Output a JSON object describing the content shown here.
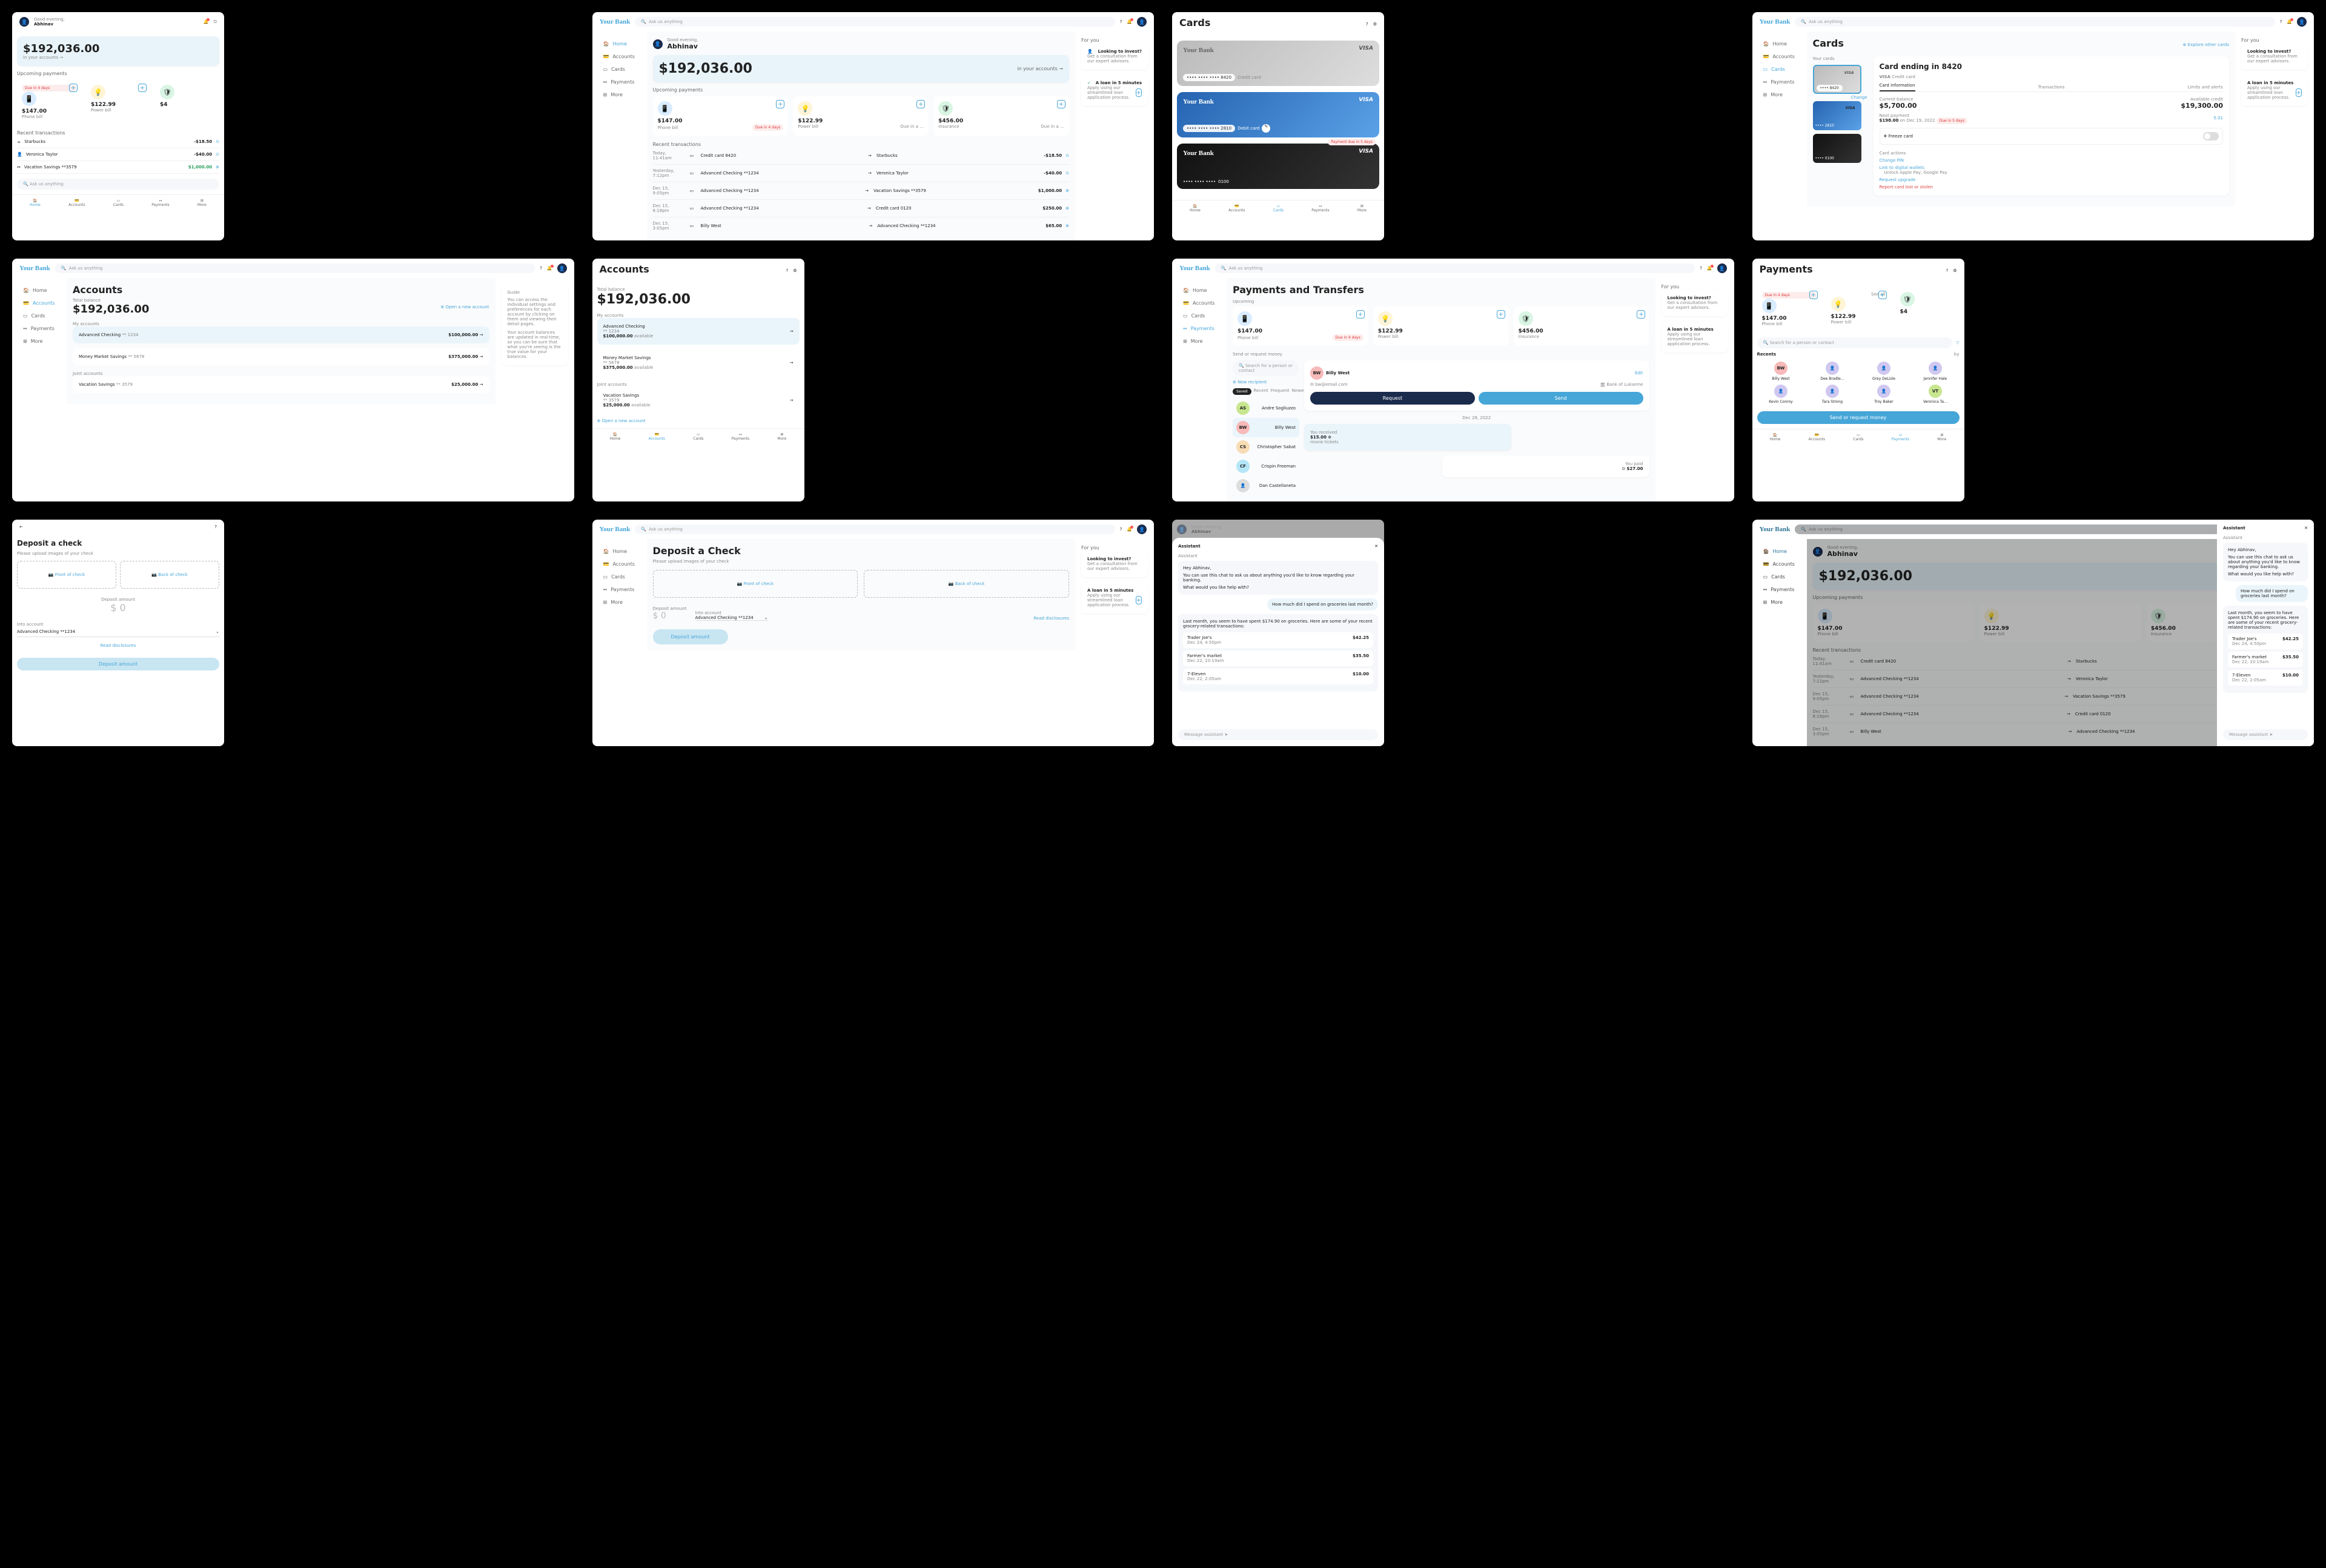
{
  "brand": "Your Bank",
  "search_placeholder": "Ask us anything",
  "greeting": {
    "label": "Good evening,",
    "name": "Abhinav"
  },
  "balance": {
    "amount": "$192,036.00",
    "sub": "in your accounts",
    "arrow": "→"
  },
  "nav": {
    "home": "Home",
    "accounts": "Accounts",
    "cards": "Cards",
    "payments": "Payments",
    "more": "More"
  },
  "upcoming": {
    "title": "Upcoming payments",
    "see_all": "See all",
    "items": [
      {
        "amt": "$147.00",
        "label": "Phone bill",
        "due": "Due in 4 days",
        "urgent": true,
        "icon": "📱"
      },
      {
        "amt": "$122.99",
        "label": "Power bill",
        "due": "Due in a …",
        "icon": "💡"
      },
      {
        "amt": "$456.00",
        "label": "Insurance",
        "due": "Due in a …",
        "icon": "🛡"
      }
    ]
  },
  "recent": {
    "title": "Recent transactions",
    "rows": [
      {
        "time": "Today, 11:41am",
        "acc": "Credit card 8420",
        "to": "Starbucks",
        "amt": "-$18.50",
        "icon": "⊙"
      },
      {
        "time": "Yesterday, 7:12pm",
        "acc": "Advanced Checking **1234",
        "to": "Veronica Taylor",
        "amt": "-$40.00",
        "icon": "⊙"
      },
      {
        "time": "Dec 15, 9:05pm",
        "acc": "Advanced Checking **1234",
        "to": "Vacation Savings **3579",
        "amt": "$1,000.00",
        "icon": "⊕"
      },
      {
        "time": "Dec 15, 8:18pm",
        "acc": "Advanced Checking **1234",
        "to": "Credit card 0120",
        "amt": "$250.00",
        "icon": "⊕"
      },
      {
        "time": "Dec 15, 3:05pm",
        "acc": "Billy West",
        "to": "Advanced Checking **1234",
        "amt": "$65.00",
        "icon": "⊕"
      }
    ],
    "rows_mobile": [
      {
        "merchant": "Starbucks",
        "sub": "Today, 11:41am",
        "amt": "-$18.50"
      },
      {
        "merchant": "Veronica Taylor",
        "sub": "Advanced Checking **1234",
        "amt": "-$40.00"
      },
      {
        "merchant": "Vacation Savings **3579",
        "sub": "Dec 15, 9:05pm",
        "amt": "$1,000.00"
      }
    ]
  },
  "foryou": {
    "title": "For you",
    "invest": {
      "title": "Looking to invest?",
      "sub": "Get a consultation from our expert advisors."
    },
    "loan": {
      "title": "A loan in 5 minutes",
      "sub": "Apply using our streamlined loan application process."
    }
  },
  "cards_page": {
    "title": "Cards",
    "explore": "Explore other cards",
    "your_cards": "Your cards",
    "card_nums": {
      "credit": "8420",
      "debit": "2810",
      "debit2": "0100"
    },
    "type_credit": "Credit card",
    "type_debit": "Debit card",
    "change": "Change",
    "detail": {
      "title": "Card ending in 8420",
      "brand": "VISA",
      "type": "Credit card",
      "tabs": {
        "info": "Card information",
        "trans": "Transactions",
        "limits": "Limits and alerts"
      },
      "current": {
        "label": "Current balance",
        "val": "$5,700.00"
      },
      "avail": {
        "label": "Available credit",
        "val": "$19,300.00"
      },
      "next": {
        "label": "Next payment",
        "val": "$198.00",
        "date": "on Dec 19, 2022",
        "pill": "Due in 5 days",
        "right": "5.01"
      },
      "freeze": "Freeze card",
      "actions_label": "Card actions",
      "actions": {
        "pin": "Change PIN",
        "wallet": "Link to digital wallets",
        "wallet_sub": "Unlock Apple Pay, Google Pay",
        "upgrade": "Request upgrade",
        "lost": "Report card lost or stolen"
      },
      "mobile_due": "Payment due in 5 days"
    }
  },
  "accounts_page": {
    "title": "Accounts",
    "total_label": "Total balance",
    "open": "Open a new account",
    "my": "My accounts",
    "joint": "Joint accounts",
    "accounts": [
      {
        "name": "Advanced Checking",
        "mask": "** 1234",
        "bal": "$100,000.00",
        "avail": "available"
      },
      {
        "name": "Money Market Savings",
        "mask": "** 5678",
        "bal": "$375,000.00",
        "avail": "available"
      }
    ],
    "joint_accounts": [
      {
        "name": "Vacation Savings",
        "mask": "** 3579",
        "bal": "$25,000.00",
        "avail": "available"
      }
    ],
    "guide": {
      "title": "Guide",
      "p1": "You can access the individual settings and preferences for each account by clicking on them and viewing their detail pages.",
      "p2": "Your account balances are updated in real-time, so you can be sure that what you're seeing is the true value for your balances."
    }
  },
  "payments_page": {
    "title": "Payments and Transfers",
    "title_m": "Payments",
    "upcoming": "Upcoming",
    "send_label": "Send or request money",
    "search_recipient": "Search for a person or contact",
    "new_recipient": "New recipient",
    "tabs": {
      "saved": "Saved",
      "recent": "Recent",
      "frequent": "Frequent",
      "newest": "Newest"
    },
    "recipients": [
      {
        "initials": "AS",
        "name": "Andre Sogliuzzo",
        "color": "#c8e68f"
      },
      {
        "initials": "BW",
        "name": "Billy West",
        "color": "#f7b9b9"
      },
      {
        "initials": "CS",
        "name": "Christopher Sabat",
        "color": "#f7dcb4"
      },
      {
        "initials": "CF",
        "name": "Crispin Freeman",
        "color": "#b4e6f7"
      },
      {
        "initials": "",
        "name": "Dan Castellaneta",
        "color": "#ddd",
        "avatar": true
      }
    ],
    "recipients_grid": [
      {
        "initials": "BW",
        "name": "Billy West",
        "color": "#f7b9b9"
      },
      {
        "initials": "",
        "name": "Dee Bradle…",
        "avatar": true
      },
      {
        "initials": "",
        "name": "Grey DeLisle",
        "avatar": true
      },
      {
        "initials": "",
        "name": "Jennifer Hale",
        "avatar": true
      },
      {
        "initials": "",
        "name": "Kevin Conroy",
        "avatar": true
      },
      {
        "initials": "",
        "name": "Tara Strong",
        "avatar": true
      },
      {
        "initials": "",
        "name": "Troy Baker",
        "avatar": true
      },
      {
        "initials": "VT",
        "name": "Veronica Ta…",
        "color": "#c8e68f"
      }
    ],
    "selected": {
      "name": "Billy West",
      "email": "bw@email.com",
      "bank": "Bank of Lukseme",
      "edit": "Edit"
    },
    "btn_request": "Request",
    "btn_send": "Send",
    "btn_send_request": "Send or request money",
    "history_date": "Dec 28, 2022",
    "history": [
      {
        "label": "You received",
        "amt": "$15.00",
        "tag": "movie tickets"
      },
      {
        "label": "You paid",
        "amt": "$27.00",
        "right": true
      }
    ],
    "tabs_label": "Recents",
    "tabs_label_filter": "by"
  },
  "deposit": {
    "title": "Deposit a Check",
    "title_m": "Deposit a check",
    "sub": "Please upload images of your check",
    "front": "Front of check",
    "back": "Back of check",
    "amount_label": "Deposit amount",
    "amount_ph": "$ 0",
    "into_label": "Into account",
    "into_val": "Advanced Checking **1234",
    "disclosures": "Read disclosures",
    "submit": "Deposit amount"
  },
  "assistant": {
    "title": "Assistant",
    "greet_label": "Assistant",
    "intro": "Hey Abhinav,",
    "intro2": "You can use this chat to ask us about anything you'd like to know regarding your banking.",
    "intro3": "What would you like help with?",
    "user_msg": "How much did I spend on groceries last month?",
    "reply": "Last month, you seem to have spent $174.90 on groceries. Here are some of your recent grocery-related transactions:",
    "expenses": [
      {
        "merchant": "Trader Joe's",
        "date": "Dec 24, 4:50pm",
        "amt": "$42.25"
      },
      {
        "merchant": "Farmer's market",
        "date": "Dec 22, 10:19am",
        "amt": "$35.50"
      },
      {
        "merchant": "7-Eleven",
        "date": "Dec 22, 2:05am",
        "amt": "$10.00"
      }
    ],
    "input_ph": "Message assistant"
  }
}
